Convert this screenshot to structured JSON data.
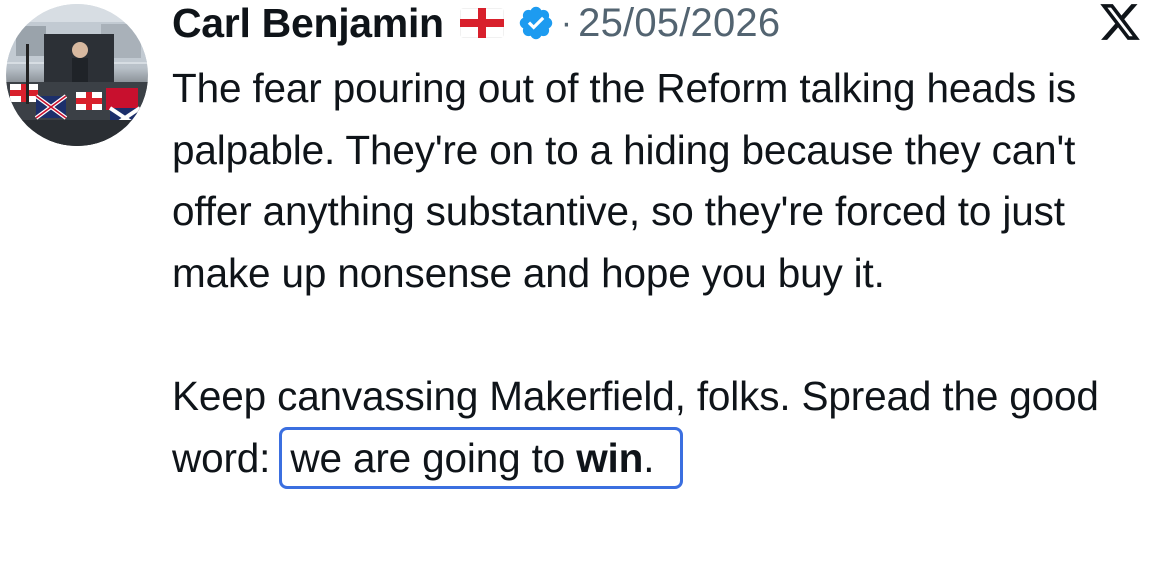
{
  "post": {
    "author_name": "Carl Benjamin",
    "author_flag": "england-flag-icon",
    "verified": "verified-badge-icon",
    "separator": "·",
    "date": "25/05/2026",
    "platform_logo": "x-logo-icon"
  },
  "body": {
    "paragraph1": "The fear pouring out of the Reform talking heads is palpable. They're on to a hiding because they can't offer anything substantive, so they're forced to just make up nonsense and hope you buy it.",
    "paragraph2_lead": "Keep canvassing Makerfield, folks. Spread the good word: ",
    "highlight_prefix": "we are going to ",
    "highlight_bold": "win",
    "highlight_suffix": "."
  },
  "colors": {
    "text": "#0f1419",
    "secondary_text": "#536471",
    "verified_blue": "#1d9bf0",
    "highlight_border": "#3b6fe0"
  }
}
